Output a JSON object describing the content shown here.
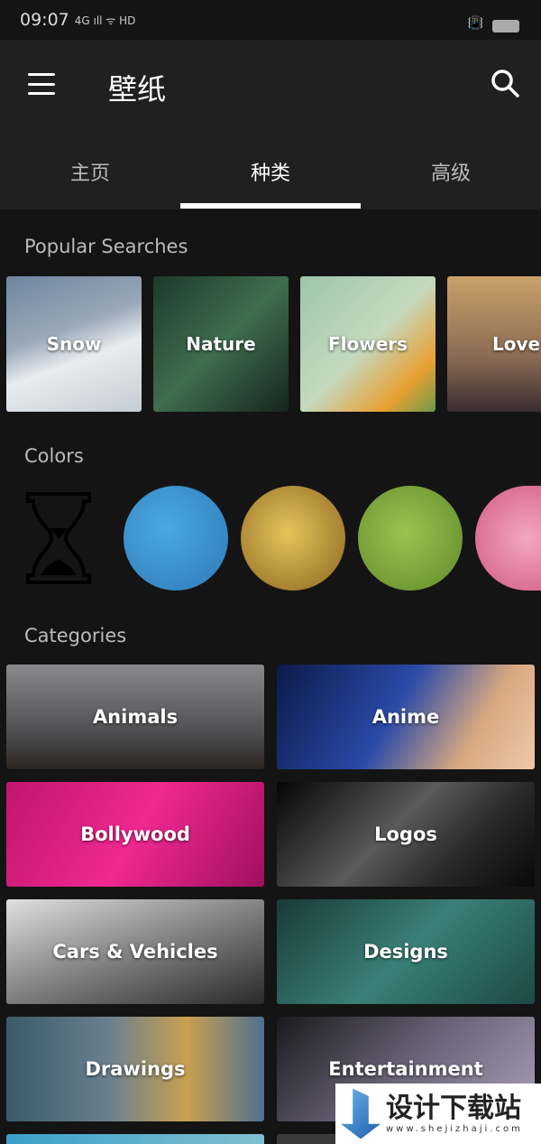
{
  "status": {
    "time": "09:07",
    "indicators": "4G ıll ᯤ HD"
  },
  "appbar": {
    "title": "壁纸",
    "menu_icon": "hamburger-icon",
    "search_icon": "search-icon"
  },
  "tabs": [
    {
      "label": "主页"
    },
    {
      "label": "种类",
      "active": true
    },
    {
      "label": "高级"
    }
  ],
  "popular": {
    "heading": "Popular Searches",
    "items": [
      {
        "label": "Snow"
      },
      {
        "label": "Nature"
      },
      {
        "label": "Flowers"
      },
      {
        "label": "Love"
      }
    ]
  },
  "colors": {
    "heading": "Colors",
    "swatches": [
      "#3a8fcc",
      "#b8902e",
      "#7fa63a",
      "#e88aa8"
    ]
  },
  "categories": {
    "heading": "Categories",
    "items": [
      {
        "label": "Animals"
      },
      {
        "label": "Anime"
      },
      {
        "label": "Bollywood"
      },
      {
        "label": "Logos"
      },
      {
        "label": "Cars & Vehicles"
      },
      {
        "label": "Designs"
      },
      {
        "label": "Drawings"
      },
      {
        "label": "Entertainment"
      },
      {
        "label": ""
      },
      {
        "label": ""
      }
    ]
  },
  "watermark": {
    "title": "设计下载站",
    "url": "www.shejizhaji.com"
  }
}
